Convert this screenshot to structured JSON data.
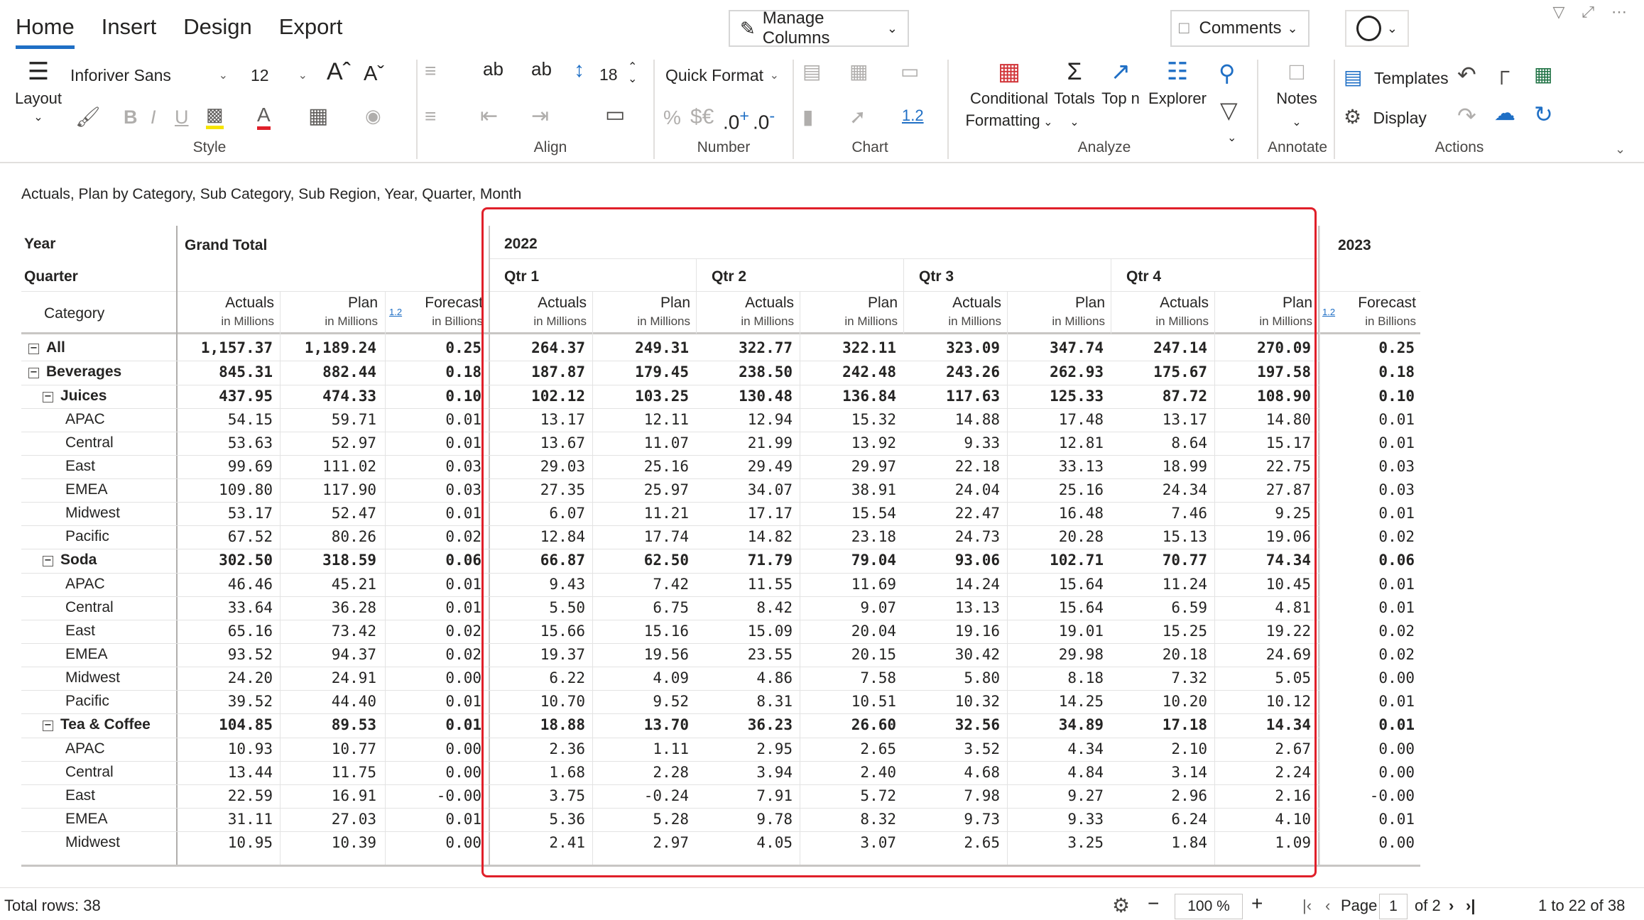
{
  "ribbon": {
    "tabs": [
      "Home",
      "Insert",
      "Design",
      "Export"
    ],
    "active_tab": "Home",
    "manage_columns": "Manage Columns",
    "comments": "Comments",
    "layout_label": "Layout",
    "font_family": "Inforiver Sans",
    "font_size": "12",
    "row_height": "18",
    "number_format": "Quick Format",
    "currency_symbols": "$€",
    "decimal_increase": ".0",
    "decimal_decrease": ".0",
    "percent": "%",
    "chart_scale": "1.2",
    "conditional_formatting": [
      "Conditional",
      "Formatting"
    ],
    "totals": "Totals",
    "top_n": "Top n",
    "explorer": "Explorer",
    "notes": "Notes",
    "templates": "Templates",
    "display": "Display",
    "groups": [
      "Style",
      "Align",
      "Number",
      "Chart",
      "Analyze",
      "Annotate",
      "Actions"
    ]
  },
  "subtitle": "Actuals, Plan by Category, Sub Category, Sub Region, Year, Quarter, Month",
  "header": {
    "year_label": "Year",
    "quarter_label": "Quarter",
    "category_label": "Category",
    "grand_total": "Grand Total",
    "year_2022": "2022",
    "year_2023": "2023",
    "quarters": [
      "Qtr 1",
      "Qtr 2",
      "Qtr 3",
      "Qtr 4"
    ],
    "actuals": "Actuals",
    "plan": "Plan",
    "forecast": "Forecast",
    "in_millions": "in Millions",
    "in_billions": "in Billions",
    "scale_badge": "1.2"
  },
  "rows": [
    {
      "label": "All",
      "level": 0,
      "bold": true,
      "toggle": true,
      "gt": [
        "1,157.37",
        "1,189.24",
        "0.25"
      ],
      "q": [
        "264.37",
        "249.31",
        "322.77",
        "322.11",
        "323.09",
        "347.74",
        "247.14",
        "270.09"
      ],
      "f23": "0.25"
    },
    {
      "label": "Beverages",
      "level": 0,
      "bold": true,
      "toggle": true,
      "gt": [
        "845.31",
        "882.44",
        "0.18"
      ],
      "q": [
        "187.87",
        "179.45",
        "238.50",
        "242.48",
        "243.26",
        "262.93",
        "175.67",
        "197.58"
      ],
      "f23": "0.18"
    },
    {
      "label": "Juices",
      "level": 1,
      "bold": true,
      "toggle": true,
      "gt": [
        "437.95",
        "474.33",
        "0.10"
      ],
      "q": [
        "102.12",
        "103.25",
        "130.48",
        "136.84",
        "117.63",
        "125.33",
        "87.72",
        "108.90"
      ],
      "f23": "0.10"
    },
    {
      "label": "APAC",
      "level": 2,
      "bold": false,
      "toggle": false,
      "gt": [
        "54.15",
        "59.71",
        "0.01"
      ],
      "q": [
        "13.17",
        "12.11",
        "12.94",
        "15.32",
        "14.88",
        "17.48",
        "13.17",
        "14.80"
      ],
      "f23": "0.01"
    },
    {
      "label": "Central",
      "level": 2,
      "bold": false,
      "toggle": false,
      "gt": [
        "53.63",
        "52.97",
        "0.01"
      ],
      "q": [
        "13.67",
        "11.07",
        "21.99",
        "13.92",
        "9.33",
        "12.81",
        "8.64",
        "15.17"
      ],
      "f23": "0.01"
    },
    {
      "label": "East",
      "level": 2,
      "bold": false,
      "toggle": false,
      "gt": [
        "99.69",
        "111.02",
        "0.03"
      ],
      "q": [
        "29.03",
        "25.16",
        "29.49",
        "29.97",
        "22.18",
        "33.13",
        "18.99",
        "22.75"
      ],
      "f23": "0.03"
    },
    {
      "label": "EMEA",
      "level": 2,
      "bold": false,
      "toggle": false,
      "gt": [
        "109.80",
        "117.90",
        "0.03"
      ],
      "q": [
        "27.35",
        "25.97",
        "34.07",
        "38.91",
        "24.04",
        "25.16",
        "24.34",
        "27.87"
      ],
      "f23": "0.03"
    },
    {
      "label": "Midwest",
      "level": 2,
      "bold": false,
      "toggle": false,
      "gt": [
        "53.17",
        "52.47",
        "0.01"
      ],
      "q": [
        "6.07",
        "11.21",
        "17.17",
        "15.54",
        "22.47",
        "16.48",
        "7.46",
        "9.25"
      ],
      "f23": "0.01"
    },
    {
      "label": "Pacific",
      "level": 2,
      "bold": false,
      "toggle": false,
      "gt": [
        "67.52",
        "80.26",
        "0.02"
      ],
      "q": [
        "12.84",
        "17.74",
        "14.82",
        "23.18",
        "24.73",
        "20.28",
        "15.13",
        "19.06"
      ],
      "f23": "0.02"
    },
    {
      "label": "Soda",
      "level": 1,
      "bold": true,
      "toggle": true,
      "gt": [
        "302.50",
        "318.59",
        "0.06"
      ],
      "q": [
        "66.87",
        "62.50",
        "71.79",
        "79.04",
        "93.06",
        "102.71",
        "70.77",
        "74.34"
      ],
      "f23": "0.06"
    },
    {
      "label": "APAC",
      "level": 2,
      "bold": false,
      "toggle": false,
      "gt": [
        "46.46",
        "45.21",
        "0.01"
      ],
      "q": [
        "9.43",
        "7.42",
        "11.55",
        "11.69",
        "14.24",
        "15.64",
        "11.24",
        "10.45"
      ],
      "f23": "0.01"
    },
    {
      "label": "Central",
      "level": 2,
      "bold": false,
      "toggle": false,
      "gt": [
        "33.64",
        "36.28",
        "0.01"
      ],
      "q": [
        "5.50",
        "6.75",
        "8.42",
        "9.07",
        "13.13",
        "15.64",
        "6.59",
        "4.81"
      ],
      "f23": "0.01"
    },
    {
      "label": "East",
      "level": 2,
      "bold": false,
      "toggle": false,
      "gt": [
        "65.16",
        "73.42",
        "0.02"
      ],
      "q": [
        "15.66",
        "15.16",
        "15.09",
        "20.04",
        "19.16",
        "19.01",
        "15.25",
        "19.22"
      ],
      "f23": "0.02"
    },
    {
      "label": "EMEA",
      "level": 2,
      "bold": false,
      "toggle": false,
      "gt": [
        "93.52",
        "94.37",
        "0.02"
      ],
      "q": [
        "19.37",
        "19.56",
        "23.55",
        "20.15",
        "30.42",
        "29.98",
        "20.18",
        "24.69"
      ],
      "f23": "0.02"
    },
    {
      "label": "Midwest",
      "level": 2,
      "bold": false,
      "toggle": false,
      "gt": [
        "24.20",
        "24.91",
        "0.00"
      ],
      "q": [
        "6.22",
        "4.09",
        "4.86",
        "7.58",
        "5.80",
        "8.18",
        "7.32",
        "5.05"
      ],
      "f23": "0.00"
    },
    {
      "label": "Pacific",
      "level": 2,
      "bold": false,
      "toggle": false,
      "gt": [
        "39.52",
        "44.40",
        "0.01"
      ],
      "q": [
        "10.70",
        "9.52",
        "8.31",
        "10.51",
        "10.32",
        "14.25",
        "10.20",
        "10.12"
      ],
      "f23": "0.01"
    },
    {
      "label": "Tea & Coffee",
      "level": 1,
      "bold": true,
      "toggle": true,
      "gt": [
        "104.85",
        "89.53",
        "0.01"
      ],
      "q": [
        "18.88",
        "13.70",
        "36.23",
        "26.60",
        "32.56",
        "34.89",
        "17.18",
        "14.34"
      ],
      "f23": "0.01"
    },
    {
      "label": "APAC",
      "level": 2,
      "bold": false,
      "toggle": false,
      "gt": [
        "10.93",
        "10.77",
        "0.00"
      ],
      "q": [
        "2.36",
        "1.11",
        "2.95",
        "2.65",
        "3.52",
        "4.34",
        "2.10",
        "2.67"
      ],
      "f23": "0.00"
    },
    {
      "label": "Central",
      "level": 2,
      "bold": false,
      "toggle": false,
      "gt": [
        "13.44",
        "11.75",
        "0.00"
      ],
      "q": [
        "1.68",
        "2.28",
        "3.94",
        "2.40",
        "4.68",
        "4.84",
        "3.14",
        "2.24"
      ],
      "f23": "0.00"
    },
    {
      "label": "East",
      "level": 2,
      "bold": false,
      "toggle": false,
      "gt": [
        "22.59",
        "16.91",
        "-0.00"
      ],
      "q": [
        "3.75",
        "-0.24",
        "7.91",
        "5.72",
        "7.98",
        "9.27",
        "2.96",
        "2.16"
      ],
      "f23": "-0.00"
    },
    {
      "label": "EMEA",
      "level": 2,
      "bold": false,
      "toggle": false,
      "gt": [
        "31.11",
        "27.03",
        "0.01"
      ],
      "q": [
        "5.36",
        "5.28",
        "9.78",
        "8.32",
        "9.73",
        "9.33",
        "6.24",
        "4.10"
      ],
      "f23": "0.01"
    },
    {
      "label": "Midwest",
      "level": 2,
      "bold": false,
      "toggle": false,
      "gt": [
        "10.95",
        "10.39",
        "0.00"
      ],
      "q": [
        "2.41",
        "2.97",
        "4.05",
        "3.07",
        "2.65",
        "3.25",
        "1.84",
        "1.09"
      ],
      "f23": "0.00"
    }
  ],
  "footer": {
    "total_rows": "Total rows: 38",
    "zoom": "100 %",
    "page_label": "Page",
    "page_value": "1",
    "page_of": "of 2",
    "range": "1 to 22 of 38"
  },
  "colors": {
    "accent": "#1f6fc5",
    "highlight": "#e0202a",
    "gridline": "#e3e3e3"
  }
}
